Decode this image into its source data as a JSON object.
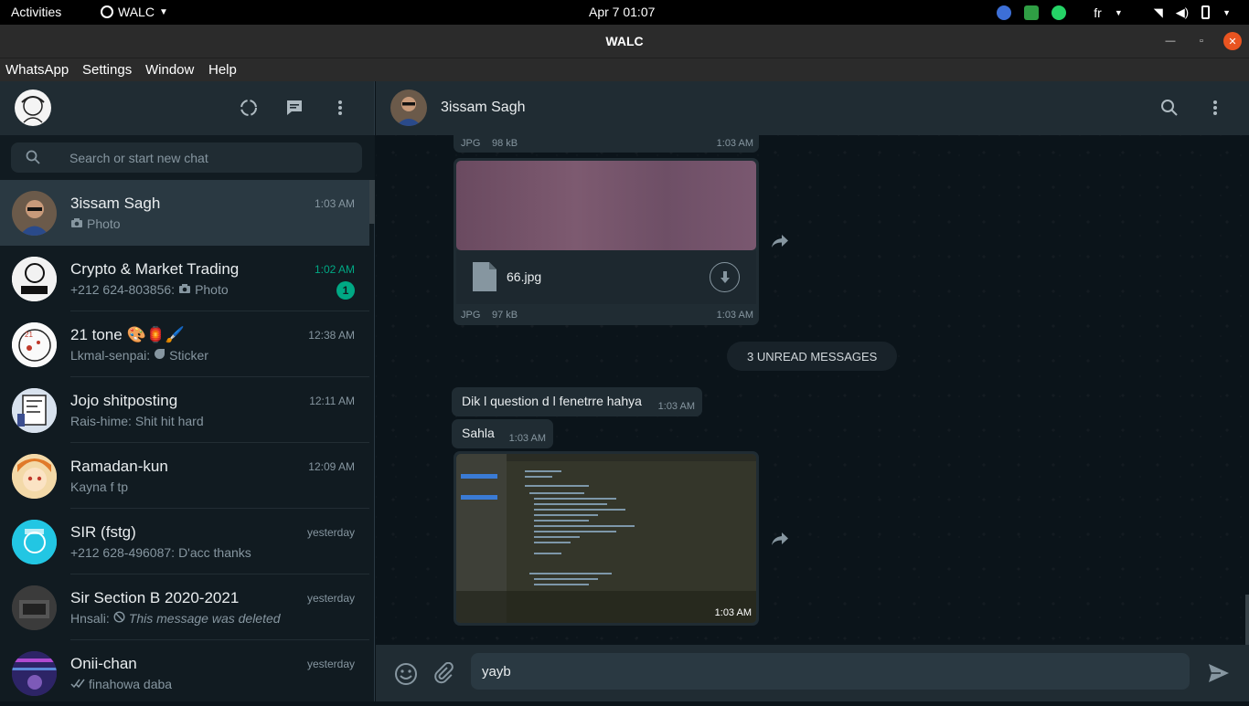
{
  "system": {
    "activities": "Activities",
    "app_name": "WALC",
    "clock": "Apr 7  01:07",
    "lang": "fr"
  },
  "window": {
    "title": "WALC"
  },
  "menu": [
    "WhatsApp",
    "Settings",
    "Window",
    "Help"
  ],
  "sidebar": {
    "search_placeholder": "Search or start new chat",
    "chats": [
      {
        "name": "3issam Sagh",
        "time": "1:03 AM",
        "preview": "Photo",
        "sender": "",
        "icon": "camera-icon",
        "active": true,
        "unread": ""
      },
      {
        "name": "Crypto & Market Trading",
        "time": "1:02 AM",
        "preview": "Photo",
        "sender": "+212 624-803856:",
        "icon": "camera-icon",
        "active": false,
        "unread": "1"
      },
      {
        "name": "21 tone 🎨🏮🖌️",
        "time": "12:38 AM",
        "preview": "Sticker",
        "sender": "Lkmal-senpai:",
        "icon": "sticker-icon",
        "active": false,
        "unread": ""
      },
      {
        "name": "Jojo shitposting",
        "time": "12:11 AM",
        "preview": "Shit hit hard",
        "sender": "Rais-hime:",
        "icon": "",
        "active": false,
        "unread": ""
      },
      {
        "name": "Ramadan-kun",
        "time": "12:09 AM",
        "preview": "Kayna f tp",
        "sender": "",
        "icon": "",
        "active": false,
        "unread": ""
      },
      {
        "name": "SIR (fstg)",
        "time": "yesterday",
        "preview": "D'acc thanks",
        "sender": "+212 628-496087:",
        "icon": "",
        "active": false,
        "unread": ""
      },
      {
        "name": "Sir Section B 2020-2021",
        "time": "yesterday",
        "preview": "This message was deleted",
        "sender": "Hnsali:",
        "icon": "deleted-icon",
        "active": false,
        "unread": ""
      },
      {
        "name": "Onii-chan",
        "time": "yesterday",
        "preview": "finahowa daba",
        "sender": "",
        "icon": "double-check-icon",
        "active": false,
        "unread": ""
      }
    ]
  },
  "conversation": {
    "contact_name": "3issam Sagh",
    "top_meta": {
      "type": "JPG",
      "size": "98 kB",
      "time": "1:03 AM"
    },
    "file_msg": {
      "filename": "66.jpg",
      "type": "JPG",
      "size": "97 kB",
      "time": "1:03 AM"
    },
    "unread_banner": "3 UNREAD MESSAGES",
    "messages": [
      {
        "text": "Dik l question d l fenetrre hahya",
        "time": "1:03 AM"
      },
      {
        "text": "Sahla",
        "time": "1:03 AM"
      }
    ],
    "image_msg_time": "1:03 AM",
    "composer_value": "yayb"
  }
}
